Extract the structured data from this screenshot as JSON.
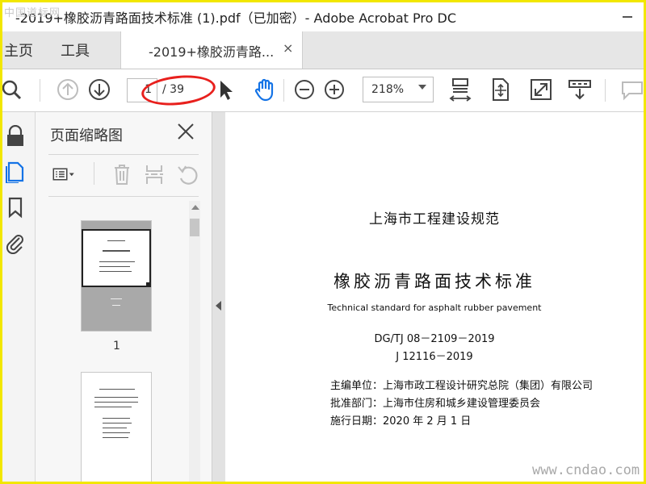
{
  "window": {
    "title": "-2019+橡胶沥青路面技术标准 (1).pdf（已加密）- Adobe Acrobat Pro DC"
  },
  "tabs": {
    "home": "主页",
    "tools": "工具",
    "document": "-2019+橡胶沥青路...",
    "close_glyph": "×"
  },
  "toolbar": {
    "current_page": "1",
    "page_count": "/ 39",
    "zoom": "218%",
    "highlight_color": "#e8201d"
  },
  "panel": {
    "title": "页面缩略图",
    "thumbnail_page_number": "1"
  },
  "document": {
    "issuer": "上海市工程建设规范",
    "title": "橡胶沥青路面技术标准",
    "english_title": "Technical standard for asphalt rubber pavement",
    "code": "DG/TJ 08－2109－2019",
    "record_no": "J 12116－2019",
    "chief_unit": "主编单位：上海市政工程设计研究总院（集团）有限公司",
    "approval": "批准部门：上海市住房和城乡建设管理委员会",
    "effective_date": "施行日期：2020 年 2 月 1 日"
  },
  "watermarks": {
    "top_left": "中国道标网",
    "bottom_right": "www.cndao.com"
  },
  "colors": {
    "accent_blue": "#1473e6",
    "frame_yellow": "#f2e700"
  }
}
